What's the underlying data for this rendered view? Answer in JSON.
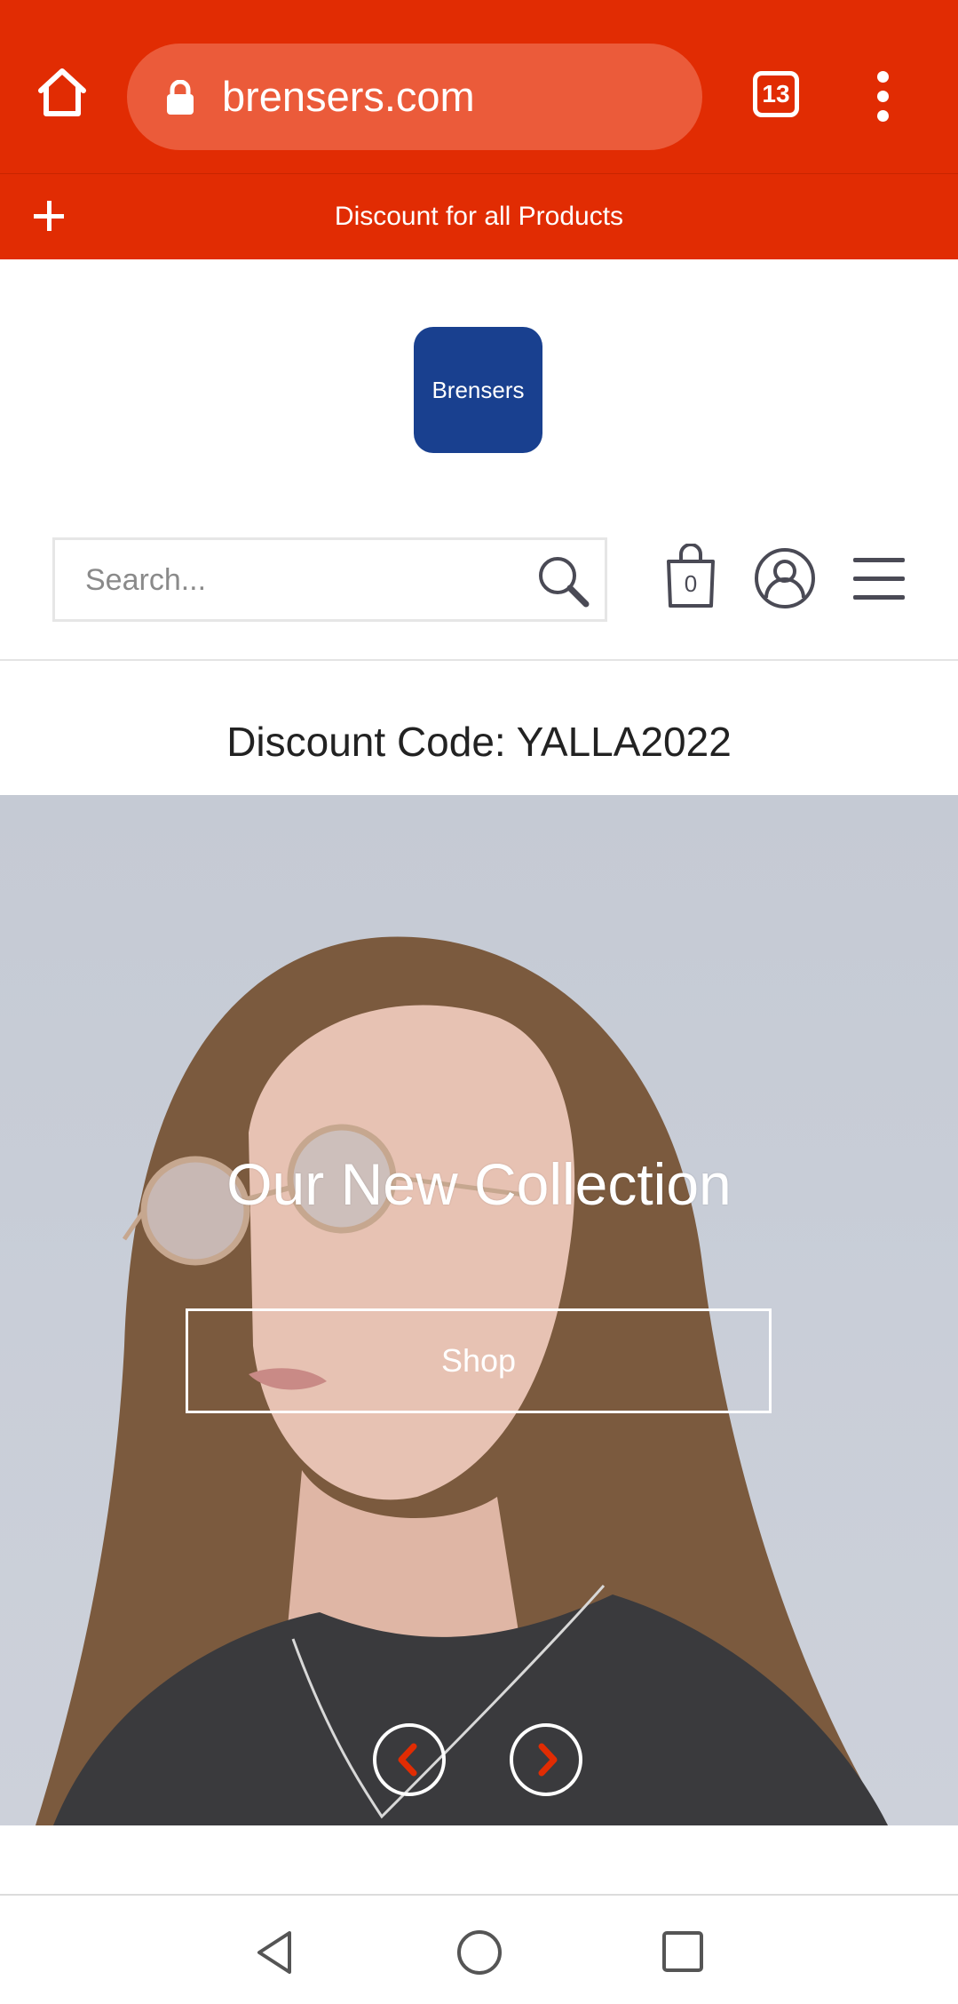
{
  "browser": {
    "url": "brensers.com",
    "tab_count": "13"
  },
  "announcement": {
    "text": "Discount for all Products"
  },
  "logo": {
    "text": "Brensers"
  },
  "search": {
    "placeholder": "Search..."
  },
  "cart": {
    "count": "0"
  },
  "discount": {
    "text": "Discount Code: YALLA2022"
  },
  "hero": {
    "title": "Our New Collection",
    "button_label": "Shop"
  },
  "icons": {
    "browser_home": "home-icon",
    "lock": "lock-icon",
    "tabs": "tabs-icon",
    "more": "more-vert-icon",
    "expand": "plus-icon",
    "search": "search-icon",
    "cart": "shopping-bag-icon",
    "account": "account-icon",
    "menu": "hamburger-icon",
    "prev": "chevron-left-icon",
    "next": "chevron-right-icon"
  },
  "colors": {
    "browser_bar": "#e12c03",
    "url_pill": "#eb5b3a",
    "logo_bg": "#19408f",
    "chevron": "#e12c03"
  }
}
